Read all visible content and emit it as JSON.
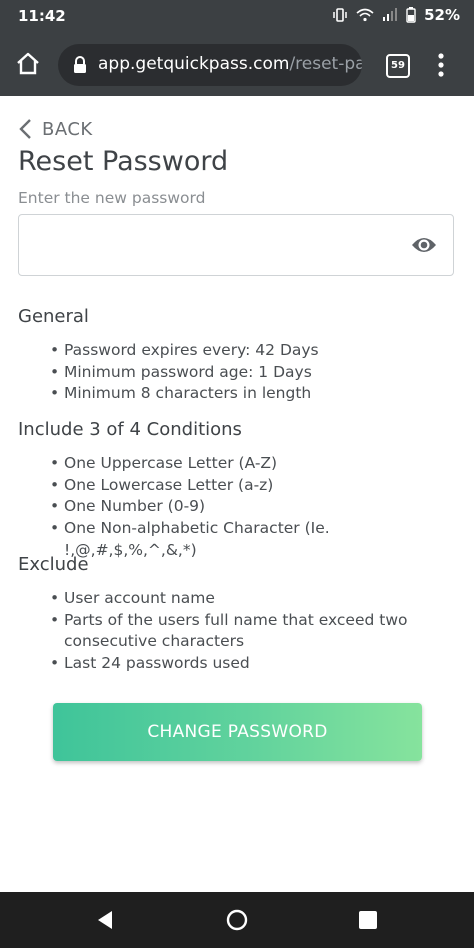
{
  "status_bar": {
    "time": "11:42",
    "battery": "52%",
    "icons": [
      "vibrate-icon",
      "wifi-icon",
      "signal-icon",
      "battery-icon"
    ]
  },
  "browser": {
    "url_main": "app.getquickpass.com",
    "url_path": "/reset-pa",
    "tab_count": "59",
    "icons": [
      "home-icon",
      "lock-icon",
      "tabs-icon",
      "more-vert-icon"
    ]
  },
  "page": {
    "back_label": "BACK",
    "title": "Reset Password",
    "input_label": "Enter the new password",
    "input_value": "",
    "sections": [
      {
        "heading": "General",
        "items": [
          "Password expires every: 42 Days",
          "Minimum password age: 1 Days",
          "Minimum 8 characters in length"
        ]
      },
      {
        "heading": "Include 3 of 4 Conditions",
        "items": [
          "One Uppercase Letter (A-Z)",
          "One Lowercase Letter (a-z)",
          "One Number (0-9)",
          "One Non-alphabetic Character (Ie. !,@,#,$,%,^,&,*)"
        ]
      },
      {
        "heading": "Exclude",
        "items": [
          "User account name",
          "Parts of the users full name that exceed two consecutive characters",
          "Last 24 passwords used"
        ]
      }
    ],
    "submit_label": "CHANGE PASSWORD"
  },
  "colors": {
    "chrome_bar": "#3c4043",
    "button_gradient_start": "#3fc49a",
    "button_gradient_end": "#86e39d",
    "nav_bar": "#1f1f1f"
  }
}
